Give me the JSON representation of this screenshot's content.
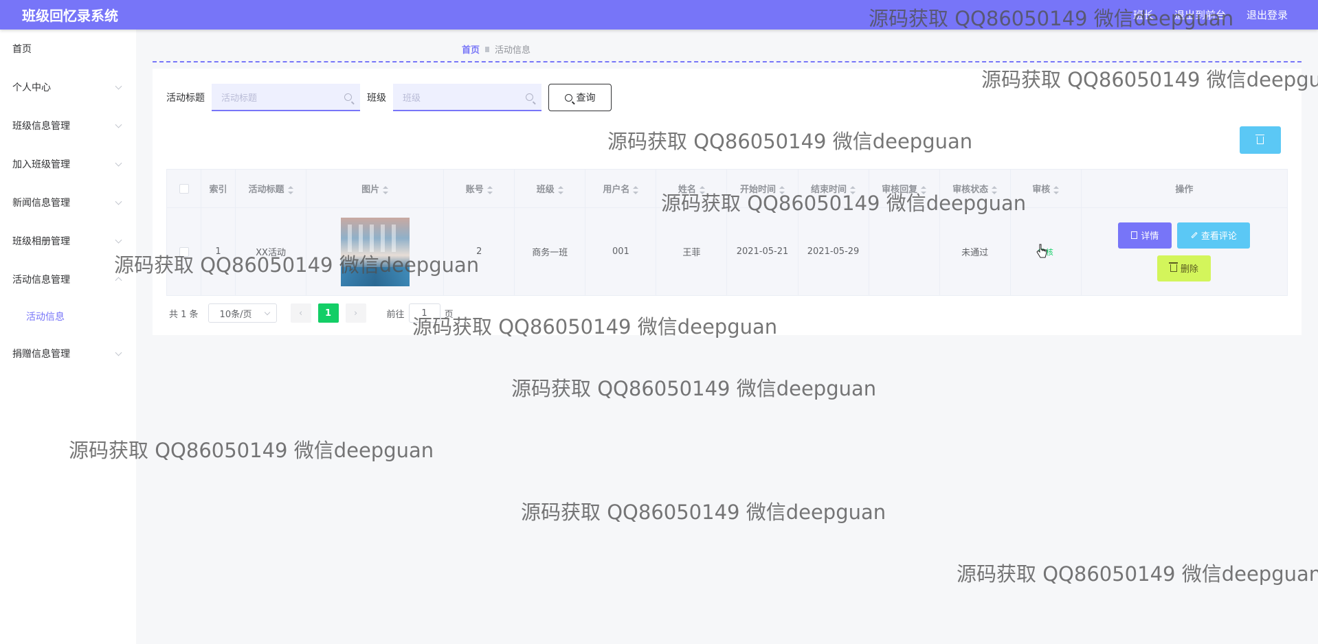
{
  "header": {
    "title": "班级回忆录系统",
    "links": [
      "班长",
      "退出到前台",
      "退出登录"
    ]
  },
  "sidebar": {
    "items": [
      {
        "label": "首页",
        "has_children": false
      },
      {
        "label": "个人中心",
        "has_children": true
      },
      {
        "label": "班级信息管理",
        "has_children": true
      },
      {
        "label": "加入班级管理",
        "has_children": true
      },
      {
        "label": "新闻信息管理",
        "has_children": true
      },
      {
        "label": "班级相册管理",
        "has_children": true
      },
      {
        "label": "活动信息管理",
        "has_children": true,
        "open": true
      },
      {
        "label": "捐赠信息管理",
        "has_children": true
      }
    ],
    "active_sub": "活动信息"
  },
  "breadcrumb": {
    "home": "首页",
    "current": "活动信息"
  },
  "search": {
    "title_label": "活动标题",
    "title_placeholder": "活动标题",
    "class_label": "班级",
    "class_placeholder": "班级",
    "query_label": "查询"
  },
  "table": {
    "headers": [
      "索引",
      "活动标题",
      "图片",
      "账号",
      "班级",
      "用户名",
      "姓名",
      "开始时间",
      "结束时间",
      "审核回复",
      "审核状态",
      "审核",
      "操作"
    ],
    "rows": [
      {
        "index": "1",
        "title": "XX活动",
        "account": "2",
        "class": "商务一班",
        "username": "001",
        "name": "王菲",
        "start": "2021-05-21",
        "end": "2021-05-29",
        "reply": "",
        "status": "未通过",
        "audit": "审核"
      }
    ],
    "actions": {
      "detail": "详情",
      "comment": "查看评论",
      "delete": "删除"
    }
  },
  "pagination": {
    "total": "共 1 条",
    "page_size": "10条/页",
    "current": "1",
    "goto_label": "前往",
    "goto_value": "1",
    "page_suffix": "页"
  },
  "watermark": "源码获取 QQ86050149 微信deepguan",
  "colors": {
    "primary": "#7775f8",
    "info": "#5bc8f5",
    "success": "#13ce66",
    "warning": "#d3f55b"
  }
}
